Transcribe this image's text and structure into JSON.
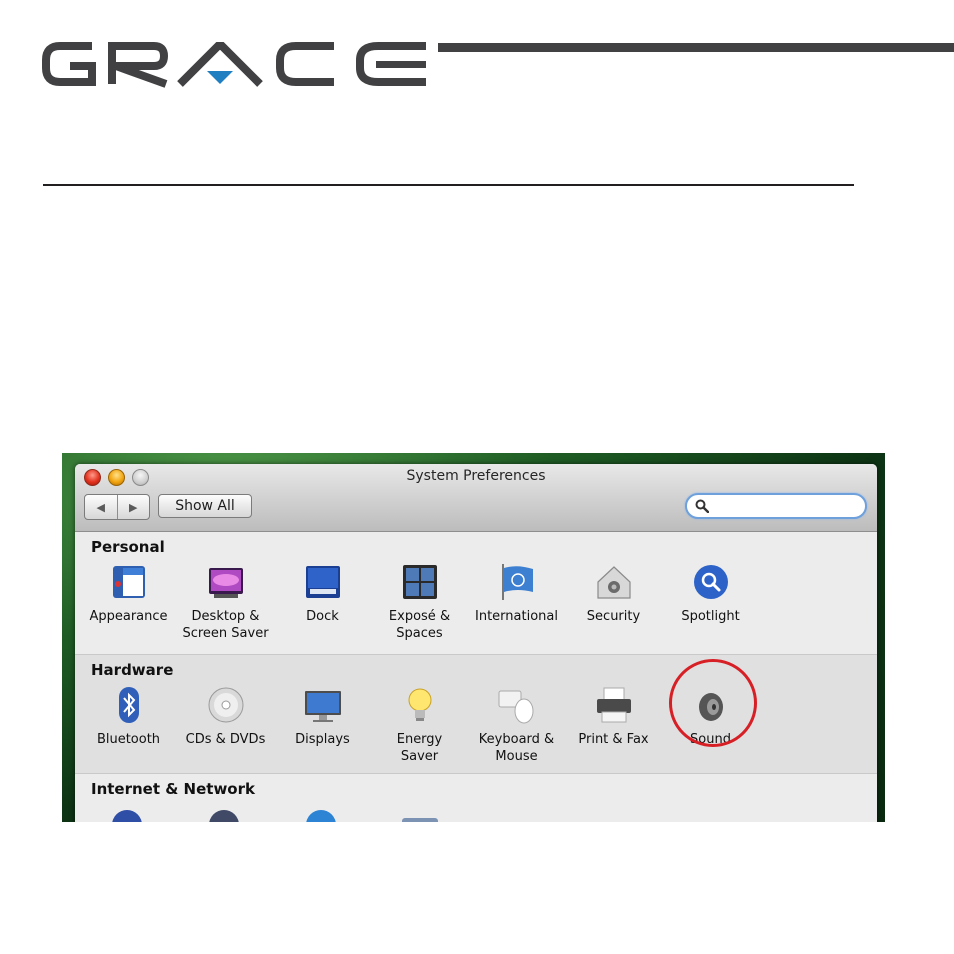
{
  "brand": {
    "logo_text": "GRACE",
    "accent_color": "#1f7fc1"
  },
  "window": {
    "title": "System Preferences"
  },
  "toolbar": {
    "back_glyph": "◀",
    "forward_glyph": "▶",
    "show_all_label": "Show All",
    "search_value": "",
    "search_icon": "magnifier-icon"
  },
  "sections": {
    "personal": {
      "title": "Personal",
      "items": [
        {
          "label": "Appearance",
          "icon": "appearance-icon"
        },
        {
          "label": "Desktop &\nScreen Saver",
          "icon": "desktop-screensaver-icon"
        },
        {
          "label": "Dock",
          "icon": "dock-icon"
        },
        {
          "label": "Exposé &\nSpaces",
          "icon": "expose-spaces-icon"
        },
        {
          "label": "International",
          "icon": "un-flag-icon"
        },
        {
          "label": "Security",
          "icon": "house-lock-icon"
        },
        {
          "label": "Spotlight",
          "icon": "spotlight-icon"
        }
      ]
    },
    "hardware": {
      "title": "Hardware",
      "items": [
        {
          "label": "Bluetooth",
          "icon": "bluetooth-icon"
        },
        {
          "label": "CDs & DVDs",
          "icon": "disc-icon"
        },
        {
          "label": "Displays",
          "icon": "display-icon"
        },
        {
          "label": "Energy\nSaver",
          "icon": "lightbulb-icon"
        },
        {
          "label": "Keyboard &\nMouse",
          "icon": "keyboard-mouse-icon"
        },
        {
          "label": "Print & Fax",
          "icon": "printer-icon"
        },
        {
          "label": "Sound",
          "icon": "speaker-icon",
          "highlighted": true
        }
      ]
    },
    "internet": {
      "title": "Internet & Network"
    }
  },
  "colors": {
    "highlight_circle": "#d71f26",
    "search_focus": "#6ea0dc"
  }
}
